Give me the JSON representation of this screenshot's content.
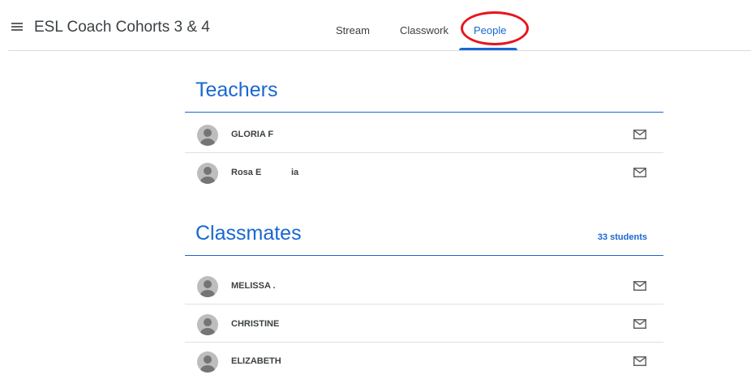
{
  "header": {
    "menu_icon": "hamburger-menu-icon",
    "class_title": "ESL Coach Cohorts 3 & 4",
    "tabs": [
      {
        "label": "Stream",
        "active": false
      },
      {
        "label": "Classwork",
        "active": false
      },
      {
        "label": "People",
        "active": true
      }
    ]
  },
  "teachers": {
    "title": "Teachers",
    "people": [
      {
        "name": "GLORIA F"
      },
      {
        "name": "Rosa E            ia"
      }
    ]
  },
  "classmates": {
    "title": "Classmates",
    "count": "33 students",
    "people": [
      {
        "name": "MELISSA ."
      },
      {
        "name": "CHRISTINE"
      },
      {
        "name": "ELIZABETH"
      }
    ]
  },
  "icons": {
    "avatar": "default-avatar-icon",
    "email": "email-envelope-icon"
  },
  "colors": {
    "accent": "#1967d2",
    "annotation": "#e8141c",
    "text": "#3c4043"
  }
}
